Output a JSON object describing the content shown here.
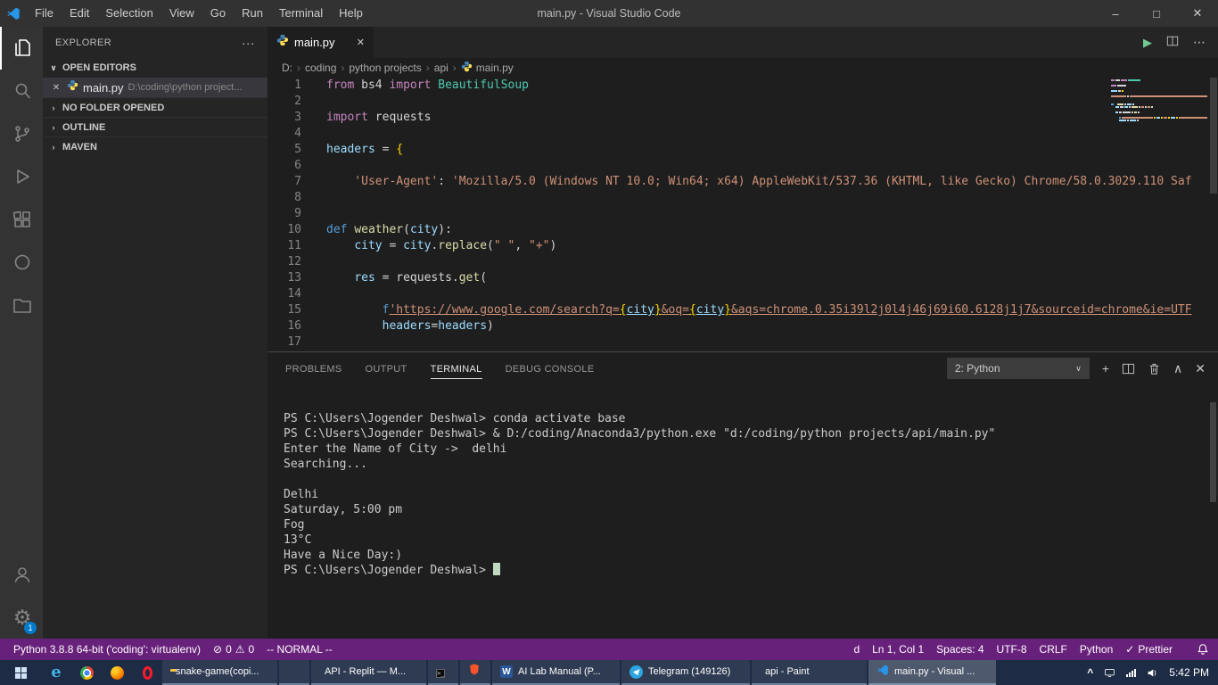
{
  "colors": {
    "accent": "#007acc",
    "status_bar": "#68217a",
    "taskbar": "#1d2b44",
    "editor_bg": "#1e1e1e"
  },
  "window": {
    "title": "main.py - Visual Studio Code",
    "menu_items": [
      "File",
      "Edit",
      "Selection",
      "View",
      "Go",
      "Run",
      "Terminal",
      "Help"
    ]
  },
  "activity_bar": {
    "items": [
      {
        "icon": "explorer-icon",
        "active": true
      },
      {
        "icon": "search-icon"
      },
      {
        "icon": "source-control-icon"
      },
      {
        "icon": "run-debug-icon"
      },
      {
        "icon": "extensions-icon"
      },
      {
        "icon": "circle-icon"
      },
      {
        "icon": "folder-outline-icon"
      }
    ],
    "bottom": [
      {
        "icon": "account-icon"
      },
      {
        "icon": "settings-gear-icon",
        "badge": "1"
      }
    ]
  },
  "sidebar": {
    "title": "EXPLORER",
    "open_editors_label": "OPEN EDITORS",
    "open_editor": {
      "file": "main.py",
      "path": "D:\\coding\\python project..."
    },
    "sections": [
      "NO FOLDER OPENED",
      "OUTLINE",
      "MAVEN"
    ]
  },
  "editor": {
    "tab": "main.py",
    "breadcrumb": [
      "D:",
      "coding",
      "python projects",
      "api",
      "main.py"
    ],
    "code": [
      {
        "n": 1,
        "tokens": [
          {
            "t": "from",
            "c": "kw"
          },
          {
            "t": " bs4 ",
            "c": "plain"
          },
          {
            "t": "import",
            "c": "kw"
          },
          {
            "t": " BeautifulSoup",
            "c": "type"
          }
        ]
      },
      {
        "n": 2,
        "tokens": []
      },
      {
        "n": 3,
        "tokens": [
          {
            "t": "import",
            "c": "kw"
          },
          {
            "t": " requests",
            "c": "plain"
          }
        ]
      },
      {
        "n": 4,
        "tokens": []
      },
      {
        "n": 5,
        "tokens": [
          {
            "t": "headers",
            "c": "var"
          },
          {
            "t": " = ",
            "c": "plain"
          },
          {
            "t": "{",
            "c": "brace"
          }
        ]
      },
      {
        "n": 6,
        "tokens": []
      },
      {
        "n": 7,
        "tokens": [
          {
            "t": "    'User-Agent'",
            "c": "str"
          },
          {
            "t": ": ",
            "c": "plain"
          },
          {
            "t": "'Mozilla/5.0 (Windows NT 10.0; Win64; x64) AppleWebKit/537.36 (KHTML, like Gecko) Chrome/58.0.3029.110 Saf",
            "c": "str"
          }
        ]
      },
      {
        "n": 8,
        "tokens": []
      },
      {
        "n": 9,
        "tokens": []
      },
      {
        "n": 10,
        "tokens": [
          {
            "t": "def",
            "c": "def"
          },
          {
            "t": " ",
            "c": "plain"
          },
          {
            "t": "weather",
            "c": "fn"
          },
          {
            "t": "(",
            "c": "plain"
          },
          {
            "t": "city",
            "c": "var"
          },
          {
            "t": "):",
            "c": "plain"
          }
        ]
      },
      {
        "n": 11,
        "tokens": [
          {
            "t": "    ",
            "c": "plain"
          },
          {
            "t": "city",
            "c": "var"
          },
          {
            "t": " = ",
            "c": "plain"
          },
          {
            "t": "city",
            "c": "var"
          },
          {
            "t": ".",
            "c": "plain"
          },
          {
            "t": "replace",
            "c": "fn"
          },
          {
            "t": "(",
            "c": "plain"
          },
          {
            "t": "\" \"",
            "c": "str"
          },
          {
            "t": ", ",
            "c": "plain"
          },
          {
            "t": "\"+\"",
            "c": "str"
          },
          {
            "t": ")",
            "c": "plain"
          }
        ]
      },
      {
        "n": 12,
        "tokens": []
      },
      {
        "n": 13,
        "tokens": [
          {
            "t": "    ",
            "c": "plain"
          },
          {
            "t": "res",
            "c": "var"
          },
          {
            "t": " = ",
            "c": "plain"
          },
          {
            "t": "requests",
            "c": "plain"
          },
          {
            "t": ".",
            "c": "plain"
          },
          {
            "t": "get",
            "c": "fn"
          },
          {
            "t": "(",
            "c": "plain"
          }
        ]
      },
      {
        "n": 14,
        "tokens": []
      },
      {
        "n": 15,
        "tokens": [
          {
            "t": "        ",
            "c": "plain"
          },
          {
            "t": "f",
            "c": "def"
          },
          {
            "t": "'https://www.google.com/search?q=",
            "c": "str u"
          },
          {
            "t": "{",
            "c": "brace u"
          },
          {
            "t": "city",
            "c": "var u"
          },
          {
            "t": "}",
            "c": "brace u"
          },
          {
            "t": "&oq=",
            "c": "str u"
          },
          {
            "t": "{",
            "c": "brace u"
          },
          {
            "t": "city",
            "c": "var u"
          },
          {
            "t": "}",
            "c": "brace u"
          },
          {
            "t": "&aqs=chrome.0.35i39l2j0l4j46j69i60.6128j1j7&sourceid=chrome&ie=UTF",
            "c": "str u"
          }
        ]
      },
      {
        "n": 16,
        "tokens": [
          {
            "t": "        ",
            "c": "plain"
          },
          {
            "t": "headers",
            "c": "var"
          },
          {
            "t": "=",
            "c": "plain"
          },
          {
            "t": "headers",
            "c": "var"
          },
          {
            "t": ")",
            "c": "plain"
          }
        ]
      },
      {
        "n": 17,
        "tokens": []
      }
    ]
  },
  "panel": {
    "tabs": [
      "PROBLEMS",
      "OUTPUT",
      "TERMINAL",
      "DEBUG CONSOLE"
    ],
    "active_tab": "TERMINAL",
    "shell_select": "2: Python",
    "terminal": [
      "PS C:\\Users\\Jogender Deshwal> conda activate base",
      "PS C:\\Users\\Jogender Deshwal> & D:/coding/Anaconda3/python.exe \"d:/coding/python projects/api/main.py\"",
      "Enter the Name of City ->  delhi",
      "Searching...",
      "",
      "Delhi",
      "Saturday, 5:00 pm",
      "Fog",
      "13°C",
      "Have a Nice Day:)"
    ],
    "prompt": "PS C:\\Users\\Jogender Deshwal> "
  },
  "status_bar": {
    "python_label": "Python 3.8.8 64-bit ('coding': virtualenv)",
    "errors": "0",
    "warnings": "0",
    "mode": "-- NORMAL --",
    "right": [
      {
        "label": "d"
      },
      {
        "label": "Ln 1, Col 1"
      },
      {
        "label": "Spaces: 4"
      },
      {
        "label": "UTF-8"
      },
      {
        "label": "CRLF"
      },
      {
        "label": "Python"
      },
      {
        "label": "Prettier",
        "icon": "check"
      }
    ]
  },
  "taskbar": {
    "pinned": [
      {
        "icon": "edge-icon"
      },
      {
        "icon": "chrome-icon"
      },
      {
        "icon": "firefox-icon"
      },
      {
        "icon": "opera-icon"
      }
    ],
    "windows": [
      {
        "icon": "folder-icon",
        "label": "snake-game(copi..."
      },
      {
        "icon": "blue-app-icon",
        "label": ""
      },
      {
        "icon": "firefox-icon",
        "label": "API - Replit — M..."
      },
      {
        "icon": "cmd-icon",
        "label": ""
      },
      {
        "icon": "brave-icon",
        "label": ""
      },
      {
        "icon": "word-icon",
        "label": "AI Lab Manual (P..."
      },
      {
        "icon": "telegram-icon",
        "label": "Telegram (149126)"
      },
      {
        "icon": "paint-icon",
        "label": "api - Paint"
      },
      {
        "icon": "vscode-icon",
        "label": "main.py - Visual ...",
        "active": true
      }
    ],
    "tray": {
      "time": "5:42 PM"
    }
  }
}
